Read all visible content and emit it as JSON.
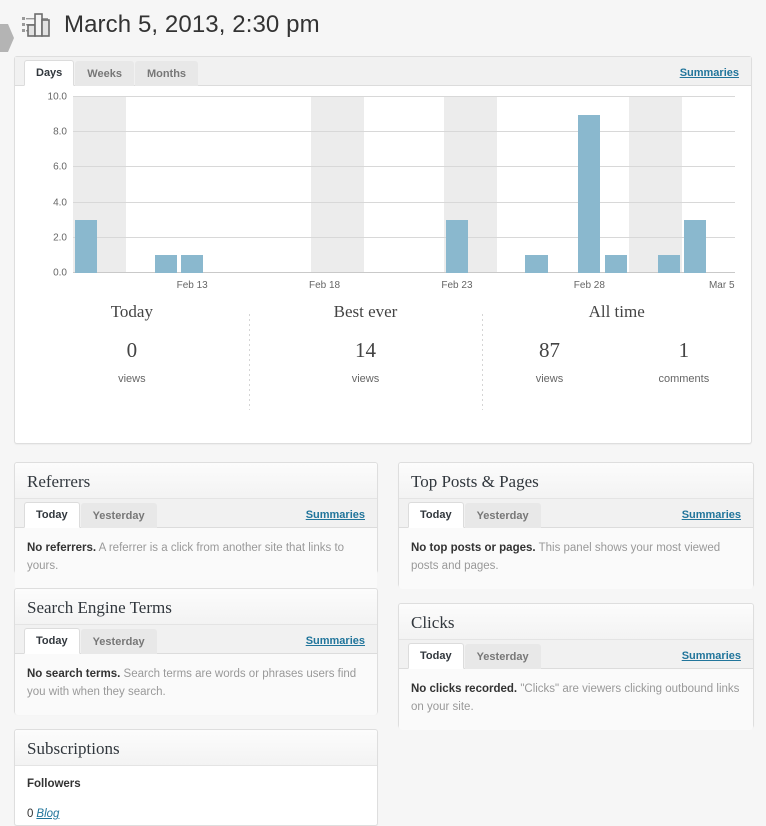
{
  "header": {
    "icon": "bar-chart-icon",
    "title": "March 5, 2013, 2:30 pm",
    "collapse_arrow": "left-arrow-icon"
  },
  "main_module": {
    "tabs": [
      {
        "label": "Days",
        "active": true
      },
      {
        "label": "Weeks",
        "active": false
      },
      {
        "label": "Months",
        "active": false
      }
    ],
    "summaries_label": "Summaries"
  },
  "chart_data": {
    "type": "bar",
    "title": "",
    "xlabel": "",
    "ylabel": "",
    "ylim": [
      0,
      10
    ],
    "yticks": [
      "0.0",
      "2.0",
      "4.0",
      "6.0",
      "8.0",
      "10.0"
    ],
    "ytick_values": [
      0,
      2,
      4,
      6,
      8,
      10
    ],
    "grid": true,
    "legend": "none",
    "bar_color": "#8ab8ce",
    "band_color": "#ececec",
    "categories": [
      "Feb 9",
      "Feb 10",
      "Feb 11",
      "Feb 12",
      "Feb 13",
      "Feb 14",
      "Feb 15",
      "Feb 16",
      "Feb 17",
      "Feb 18",
      "Feb 19",
      "Feb 20",
      "Feb 21",
      "Feb 22",
      "Feb 23",
      "Feb 24",
      "Feb 25",
      "Feb 26",
      "Feb 27",
      "Feb 28",
      "Mar 1",
      "Mar 2",
      "Mar 3",
      "Mar 4",
      "Mar 5"
    ],
    "values": [
      3,
      0,
      0,
      1,
      1,
      0,
      0,
      0,
      0,
      0,
      0,
      0,
      0,
      0,
      3,
      0,
      0,
      1,
      0,
      9,
      1,
      0,
      1,
      3,
      0
    ],
    "xtick_labels": [
      "Feb 13",
      "Feb 18",
      "Feb 23",
      "Feb 28",
      "Mar 5"
    ],
    "xtick_indices": [
      4,
      9,
      14,
      19,
      24
    ],
    "shaded_band_indices": [
      [
        0,
        1
      ],
      [
        9,
        10
      ],
      [
        14,
        15
      ],
      [
        21,
        22
      ]
    ]
  },
  "stats": [
    {
      "label": "Today",
      "columns": [
        {
          "value": "0",
          "unit": "views"
        }
      ]
    },
    {
      "label": "Best ever",
      "columns": [
        {
          "value": "14",
          "unit": "views"
        }
      ]
    },
    {
      "label": "All time",
      "columns": [
        {
          "value": "87",
          "unit": "views"
        },
        {
          "value": "1",
          "unit": "comments"
        }
      ]
    }
  ],
  "panels": {
    "referrers": {
      "title": "Referrers",
      "tabs": [
        {
          "label": "Today",
          "active": true
        },
        {
          "label": "Yesterday",
          "active": false
        }
      ],
      "summaries_label": "Summaries",
      "empty_strong": "No referrers.",
      "empty_text": "A referrer is a click from another site that links to yours."
    },
    "top_posts": {
      "title": "Top Posts & Pages",
      "tabs": [
        {
          "label": "Today",
          "active": true
        },
        {
          "label": "Yesterday",
          "active": false
        }
      ],
      "summaries_label": "Summaries",
      "empty_strong": "No top posts or pages.",
      "empty_text": "This panel shows your most viewed posts and pages."
    },
    "search_terms": {
      "title": "Search Engine Terms",
      "tabs": [
        {
          "label": "Today",
          "active": true
        },
        {
          "label": "Yesterday",
          "active": false
        }
      ],
      "summaries_label": "Summaries",
      "empty_strong": "No search terms.",
      "empty_text": "Search terms are words or phrases users find you with when they search."
    },
    "clicks": {
      "title": "Clicks",
      "tabs": [
        {
          "label": "Today",
          "active": true
        },
        {
          "label": "Yesterday",
          "active": false
        }
      ],
      "summaries_label": "Summaries",
      "empty_strong": "No clicks recorded.",
      "empty_text": "\"Clicks\" are viewers clicking outbound links on your site."
    },
    "subscriptions": {
      "title": "Subscriptions",
      "followers_heading": "Followers",
      "count": "0",
      "link_label": "Blog"
    }
  },
  "colors": {
    "accent_link": "#21759b",
    "bar": "#8ab8ce",
    "panel_border": "#dedede",
    "page_bg": "#f6f6f6"
  }
}
